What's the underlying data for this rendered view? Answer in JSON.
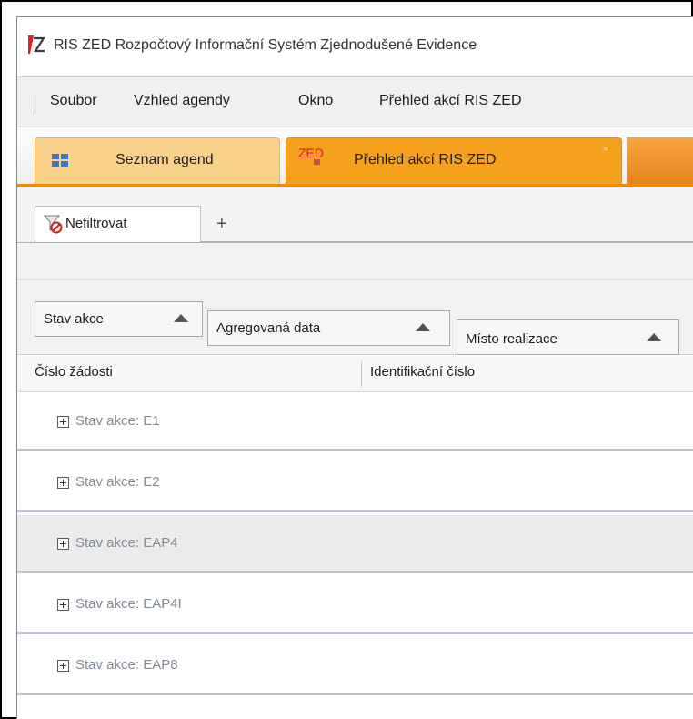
{
  "window": {
    "title": "RIS ZED Rozpočtový Informační Systém Zjednodušené Evidence",
    "logo_text": "Z"
  },
  "menu": {
    "items": [
      "Soubor",
      "Vzhled agendy",
      "Okno",
      "Přehled akcí RIS ZED"
    ]
  },
  "doc_tabs": [
    {
      "label": "Seznam agend",
      "icon": "grid-icon"
    },
    {
      "label": "Přehled akcí RIS ZED",
      "icon": "zed-icon",
      "icon_text": "ZED",
      "close": "×"
    }
  ],
  "filter_tabs": {
    "active_label": "Nefiltrovat",
    "add_label": "+"
  },
  "group_by": [
    "Stav akce",
    "Agregovaná data",
    "Místo realizace"
  ],
  "columns": [
    "Číslo žádosti",
    "Identifikační číslo"
  ],
  "groups": [
    "Stav akce: E1",
    "Stav akce: E2",
    "Stav akce: EAP4",
    "Stav akce: EAP4I",
    "Stav akce: EAP8"
  ],
  "colors": {
    "accent": "#ef8c0a",
    "tab_active": "#f5a11e",
    "tab_inactive": "#f9d18a",
    "group_text": "#7f8a95"
  }
}
